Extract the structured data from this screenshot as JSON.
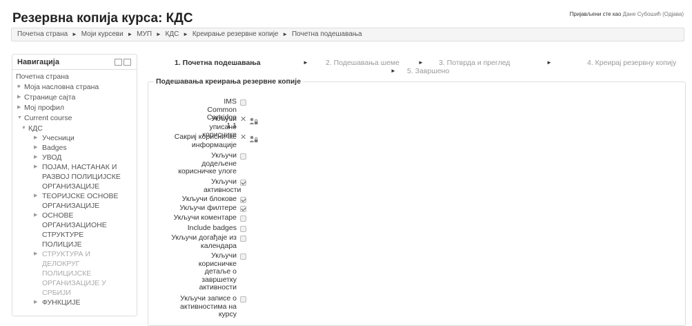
{
  "header": {
    "title": "Резервна копија курса: КДС",
    "login_prefix": "Пријављени сте као",
    "user_name": "Дане Субошић",
    "logout_label": "(Одјава)"
  },
  "breadcrumb": {
    "items": [
      "Почетна страна",
      "Моји курсеви",
      "МУП",
      "КДС",
      "Креирање резервне копије",
      "Почетна подешавања"
    ],
    "separator": "►"
  },
  "navigation": {
    "title": "Навигација",
    "items": [
      {
        "label": "Почетна страна",
        "glyph": ""
      },
      {
        "label": "Моја насловна страна",
        "glyph": "■"
      },
      {
        "label": "Странице сајта",
        "glyph": "▶"
      },
      {
        "label": "Мој профил",
        "glyph": "▶"
      },
      {
        "label": "Current course",
        "glyph": "▼"
      },
      {
        "label": "КДС",
        "glyph": "▼"
      },
      {
        "label": "Учесници",
        "glyph": "▶"
      },
      {
        "label": "Badges",
        "glyph": "▶"
      },
      {
        "label": "УВОД",
        "glyph": "▶"
      },
      {
        "label": "ПОЈАМ, НАСТАНАК И РАЗВОЈ ПОЛИЦИЈСКЕ ОРГАНИЗАЦИЈЕ",
        "glyph": "▶"
      },
      {
        "label": "ТЕОРИЈСКЕ ОСНОВЕ ОРГАНИЗАЦИЈЕ",
        "glyph": "▶"
      },
      {
        "label": "ОСНОВЕ ОРГАНИЗАЦИОНЕ СТРУКТУРЕ ПОЛИЦИЈЕ",
        "glyph": "▶"
      },
      {
        "label": "СТРУКТУРА И ДЕЛОКРУГ ПОЛИЦИЈСКЕ ОРГАНИЗАЦИЈЕ У СРБИЈИ",
        "glyph": "▶"
      },
      {
        "label": "ФУНКЦИЈЕ",
        "glyph": "▶"
      }
    ]
  },
  "steps": {
    "items": [
      "1. Почетна подешавања",
      "2. Подешавања шеме",
      "3. Потврда и преглед",
      "4. Креирај резервну копију",
      "5. Завршено"
    ],
    "arrow": "►"
  },
  "settings": {
    "legend": "Подешавања креирања резервне копије",
    "rows": [
      {
        "label": "IMS Common Cartridge 1.1",
        "state": "unchecked"
      },
      {
        "label": "Укључи уписане кориснике",
        "state": "locked"
      },
      {
        "label": "Сакриј корисничке информације",
        "state": "locked"
      },
      {
        "label": "Укључи додељене корисничке улоге",
        "state": "unchecked"
      },
      {
        "label": "Укључи активности",
        "state": "checked"
      },
      {
        "label": "Укључи блокове",
        "state": "checked"
      },
      {
        "label": "Укључи филтере",
        "state": "checked"
      },
      {
        "label": "Укључи коментаре",
        "state": "unchecked"
      },
      {
        "label": "Include badges",
        "state": "unchecked"
      },
      {
        "label": "Укључи догађаје из календара",
        "state": "unchecked"
      },
      {
        "label": "Укључи корисничке детаље о завршетку активности",
        "state": "unchecked"
      },
      {
        "label": "Укључи записе о активностима на курсу",
        "state": "unchecked"
      }
    ]
  }
}
